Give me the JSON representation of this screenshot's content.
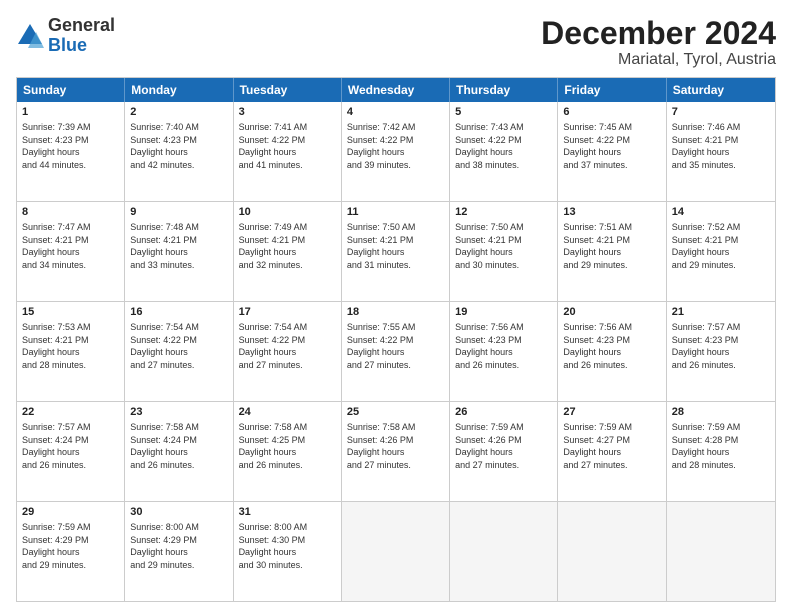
{
  "logo": {
    "general": "General",
    "blue": "Blue"
  },
  "title": "December 2024",
  "location": "Mariatal, Tyrol, Austria",
  "headers": [
    "Sunday",
    "Monday",
    "Tuesday",
    "Wednesday",
    "Thursday",
    "Friday",
    "Saturday"
  ],
  "weeks": [
    [
      {
        "day": "1",
        "sunrise": "7:39 AM",
        "sunset": "4:23 PM",
        "daylight": "8 hours and 44 minutes."
      },
      {
        "day": "2",
        "sunrise": "7:40 AM",
        "sunset": "4:23 PM",
        "daylight": "8 hours and 42 minutes."
      },
      {
        "day": "3",
        "sunrise": "7:41 AM",
        "sunset": "4:22 PM",
        "daylight": "8 hours and 41 minutes."
      },
      {
        "day": "4",
        "sunrise": "7:42 AM",
        "sunset": "4:22 PM",
        "daylight": "8 hours and 39 minutes."
      },
      {
        "day": "5",
        "sunrise": "7:43 AM",
        "sunset": "4:22 PM",
        "daylight": "8 hours and 38 minutes."
      },
      {
        "day": "6",
        "sunrise": "7:45 AM",
        "sunset": "4:22 PM",
        "daylight": "8 hours and 37 minutes."
      },
      {
        "day": "7",
        "sunrise": "7:46 AM",
        "sunset": "4:21 PM",
        "daylight": "8 hours and 35 minutes."
      }
    ],
    [
      {
        "day": "8",
        "sunrise": "7:47 AM",
        "sunset": "4:21 PM",
        "daylight": "8 hours and 34 minutes."
      },
      {
        "day": "9",
        "sunrise": "7:48 AM",
        "sunset": "4:21 PM",
        "daylight": "8 hours and 33 minutes."
      },
      {
        "day": "10",
        "sunrise": "7:49 AM",
        "sunset": "4:21 PM",
        "daylight": "8 hours and 32 minutes."
      },
      {
        "day": "11",
        "sunrise": "7:50 AM",
        "sunset": "4:21 PM",
        "daylight": "8 hours and 31 minutes."
      },
      {
        "day": "12",
        "sunrise": "7:50 AM",
        "sunset": "4:21 PM",
        "daylight": "8 hours and 30 minutes."
      },
      {
        "day": "13",
        "sunrise": "7:51 AM",
        "sunset": "4:21 PM",
        "daylight": "8 hours and 29 minutes."
      },
      {
        "day": "14",
        "sunrise": "7:52 AM",
        "sunset": "4:21 PM",
        "daylight": "8 hours and 29 minutes."
      }
    ],
    [
      {
        "day": "15",
        "sunrise": "7:53 AM",
        "sunset": "4:21 PM",
        "daylight": "8 hours and 28 minutes."
      },
      {
        "day": "16",
        "sunrise": "7:54 AM",
        "sunset": "4:22 PM",
        "daylight": "8 hours and 27 minutes."
      },
      {
        "day": "17",
        "sunrise": "7:54 AM",
        "sunset": "4:22 PM",
        "daylight": "8 hours and 27 minutes."
      },
      {
        "day": "18",
        "sunrise": "7:55 AM",
        "sunset": "4:22 PM",
        "daylight": "8 hours and 27 minutes."
      },
      {
        "day": "19",
        "sunrise": "7:56 AM",
        "sunset": "4:23 PM",
        "daylight": "8 hours and 26 minutes."
      },
      {
        "day": "20",
        "sunrise": "7:56 AM",
        "sunset": "4:23 PM",
        "daylight": "8 hours and 26 minutes."
      },
      {
        "day": "21",
        "sunrise": "7:57 AM",
        "sunset": "4:23 PM",
        "daylight": "8 hours and 26 minutes."
      }
    ],
    [
      {
        "day": "22",
        "sunrise": "7:57 AM",
        "sunset": "4:24 PM",
        "daylight": "8 hours and 26 minutes."
      },
      {
        "day": "23",
        "sunrise": "7:58 AM",
        "sunset": "4:24 PM",
        "daylight": "8 hours and 26 minutes."
      },
      {
        "day": "24",
        "sunrise": "7:58 AM",
        "sunset": "4:25 PM",
        "daylight": "8 hours and 26 minutes."
      },
      {
        "day": "25",
        "sunrise": "7:58 AM",
        "sunset": "4:26 PM",
        "daylight": "8 hours and 27 minutes."
      },
      {
        "day": "26",
        "sunrise": "7:59 AM",
        "sunset": "4:26 PM",
        "daylight": "8 hours and 27 minutes."
      },
      {
        "day": "27",
        "sunrise": "7:59 AM",
        "sunset": "4:27 PM",
        "daylight": "8 hours and 27 minutes."
      },
      {
        "day": "28",
        "sunrise": "7:59 AM",
        "sunset": "4:28 PM",
        "daylight": "8 hours and 28 minutes."
      }
    ],
    [
      {
        "day": "29",
        "sunrise": "7:59 AM",
        "sunset": "4:29 PM",
        "daylight": "8 hours and 29 minutes."
      },
      {
        "day": "30",
        "sunrise": "8:00 AM",
        "sunset": "4:29 PM",
        "daylight": "8 hours and 29 minutes."
      },
      {
        "day": "31",
        "sunrise": "8:00 AM",
        "sunset": "4:30 PM",
        "daylight": "8 hours and 30 minutes."
      },
      null,
      null,
      null,
      null
    ]
  ]
}
